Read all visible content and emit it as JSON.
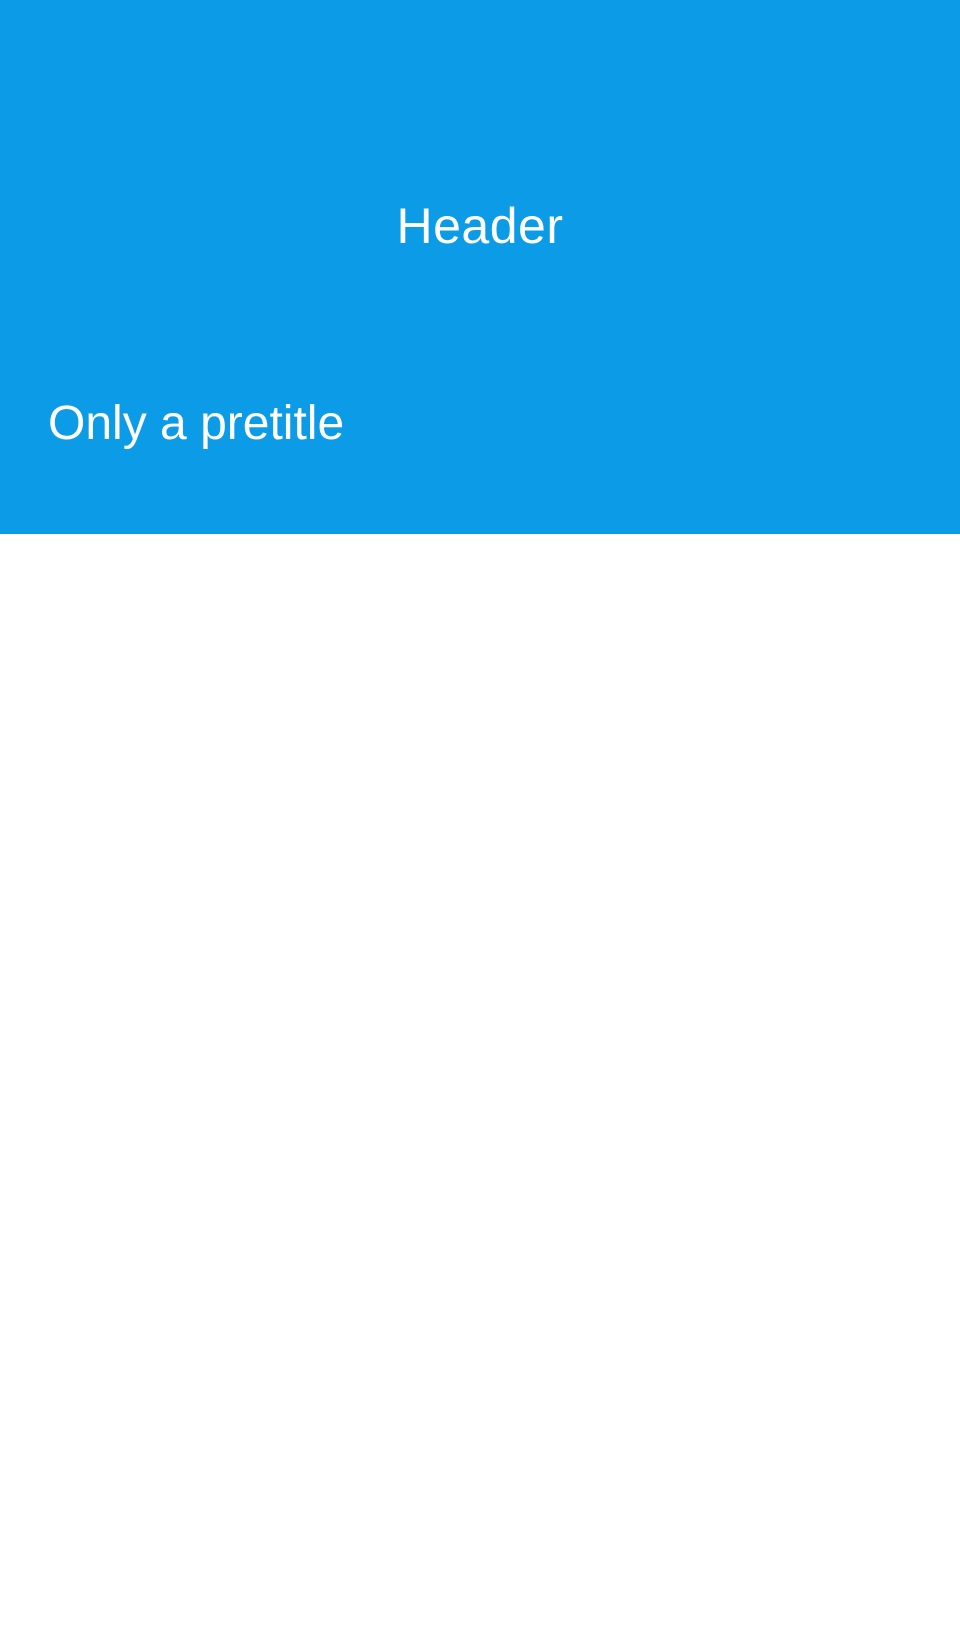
{
  "header": {
    "title": "Header",
    "background_color": "#0c9be6",
    "text_color": "#ffffff"
  },
  "hero": {
    "pretitle": "Only a pretitle"
  }
}
